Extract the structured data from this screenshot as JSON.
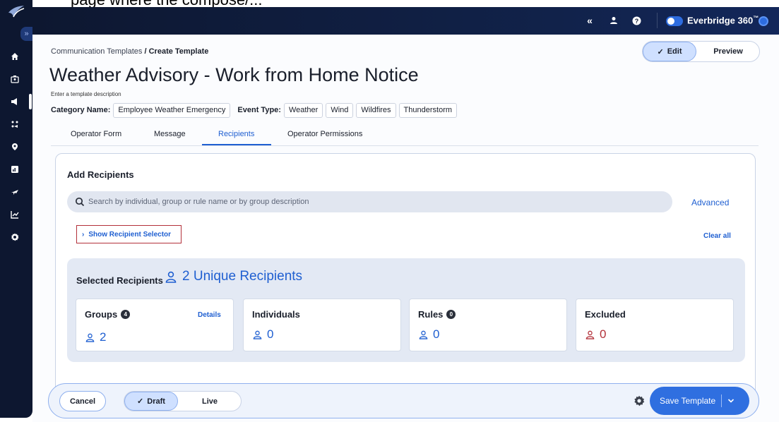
{
  "top_caption": "page where the compose/...",
  "topbar": {
    "collapse_icon": "«",
    "brand_name": "Everbridge 360",
    "brand_tm": "™"
  },
  "breadcrumb": {
    "parent": "Communication Templates",
    "separator": "/",
    "current": "Create Template"
  },
  "mode_toggle": {
    "edit_label": "Edit",
    "preview_label": "Preview",
    "selected": "Edit"
  },
  "template": {
    "title": "Weather Advisory - Work from Home Notice",
    "description_placeholder": "Enter a template description",
    "category_label": "Category Name:",
    "category_value": "Employee Weather Emergency",
    "event_type_label": "Event Type:",
    "event_types": [
      "Weather",
      "Wind",
      "Wildfires",
      "Thunderstorm"
    ]
  },
  "tabs": [
    {
      "label": "Operator Form"
    },
    {
      "label": "Message"
    },
    {
      "label": "Recipients",
      "active": true
    },
    {
      "label": "Operator Permissions"
    }
  ],
  "recipients": {
    "heading": "Add Recipients",
    "search_placeholder": "Search by individual, group or rule name or by group description",
    "advanced_label": "Advanced",
    "show_selector_label": "Show Recipient Selector",
    "clear_all_label": "Clear all",
    "selected_heading": "Selected Recipients",
    "unique_count_label": "2 Unique Recipients",
    "stats": {
      "groups": {
        "label": "Groups",
        "badge": "4",
        "details_label": "Details",
        "value": "2"
      },
      "individuals": {
        "label": "Individuals",
        "value": "0"
      },
      "rules": {
        "label": "Rules",
        "badge": "0",
        "value": "0"
      },
      "excluded": {
        "label": "Excluded",
        "value": "0"
      }
    }
  },
  "footer": {
    "cancel_label": "Cancel",
    "draft_label": "Draft",
    "live_label": "Live",
    "selected": "Draft",
    "save_label": "Save Template"
  },
  "colors": {
    "accent": "#1f5fd1",
    "sidebar": "#0d1730",
    "excluded": "#b3313a",
    "save_button": "#2f6fe0"
  }
}
